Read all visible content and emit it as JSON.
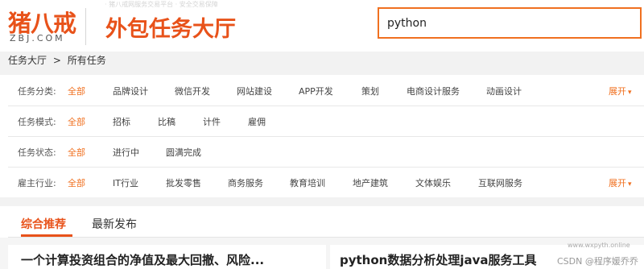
{
  "header": {
    "logo_text": "猪八戒",
    "logo_sub": "ZBJ.COM",
    "title": "外包任务大厅",
    "faint_text": "· 猪八戒网服务交易平台 · 安全交易保障"
  },
  "search": {
    "value": "python",
    "placeholder": ""
  },
  "breadcrumb": {
    "root": "任务大厅",
    "separator": ">",
    "current": "所有任务"
  },
  "filters": [
    {
      "label": "任务分类:",
      "options": [
        "全部",
        "品牌设计",
        "微信开发",
        "网站建设",
        "APP开发",
        "策划",
        "电商设计服务",
        "动画设计"
      ],
      "expand": "展开"
    },
    {
      "label": "任务模式:",
      "options": [
        "全部",
        "招标",
        "比稿",
        "计件",
        "雇佣"
      ],
      "expand": ""
    },
    {
      "label": "任务状态:",
      "options": [
        "全部",
        "进行中",
        "圆满完成"
      ],
      "expand": ""
    },
    {
      "label": "雇主行业:",
      "options": [
        "全部",
        "IT行业",
        "批发零售",
        "商务服务",
        "教育培训",
        "地产建筑",
        "文体娱乐",
        "互联网服务"
      ],
      "expand": "展开"
    }
  ],
  "tabs": [
    "综合推荐",
    "最新发布"
  ],
  "cards": [
    {
      "title": "一个计算投资组合的净值及最大回撤、风险..."
    },
    {
      "title": "python数据分析处理java服务工具"
    }
  ],
  "watermark": {
    "text": "CSDN @程序媛乔乔",
    "small": "www.wxpyth.online"
  },
  "colors": {
    "brand": "#e8521a",
    "accent": "#f07020"
  }
}
